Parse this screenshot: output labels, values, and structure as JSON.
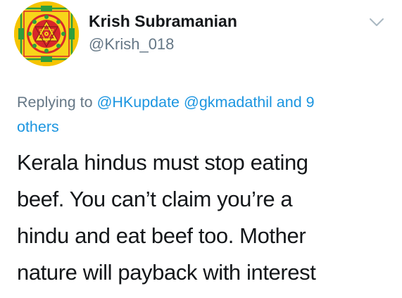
{
  "author": {
    "display_name": "Krish Subramanian",
    "handle": "@Krish_018",
    "avatar_icon": "sri-yantra-avatar"
  },
  "menu": {
    "icon": "chevron-down-icon"
  },
  "reply_context": {
    "prefix": "Replying to",
    "mentions": [
      "@HKupdate",
      "@gkmadathil"
    ],
    "connector": "and",
    "others_count": "9",
    "others_label": "others"
  },
  "tweet_text": {
    "lines": [
      "Kerala hindus must stop eating",
      "beef. You can’t claim you’re a",
      "hindu and eat beef too. Mother",
      "nature will payback with interest"
    ]
  },
  "colors": {
    "text": "#14171a",
    "muted": "#657786",
    "link": "#1b95e0",
    "avatar_yellow": "#f5c400",
    "avatar_red": "#d8262a",
    "avatar_green": "#2e9e3e"
  }
}
